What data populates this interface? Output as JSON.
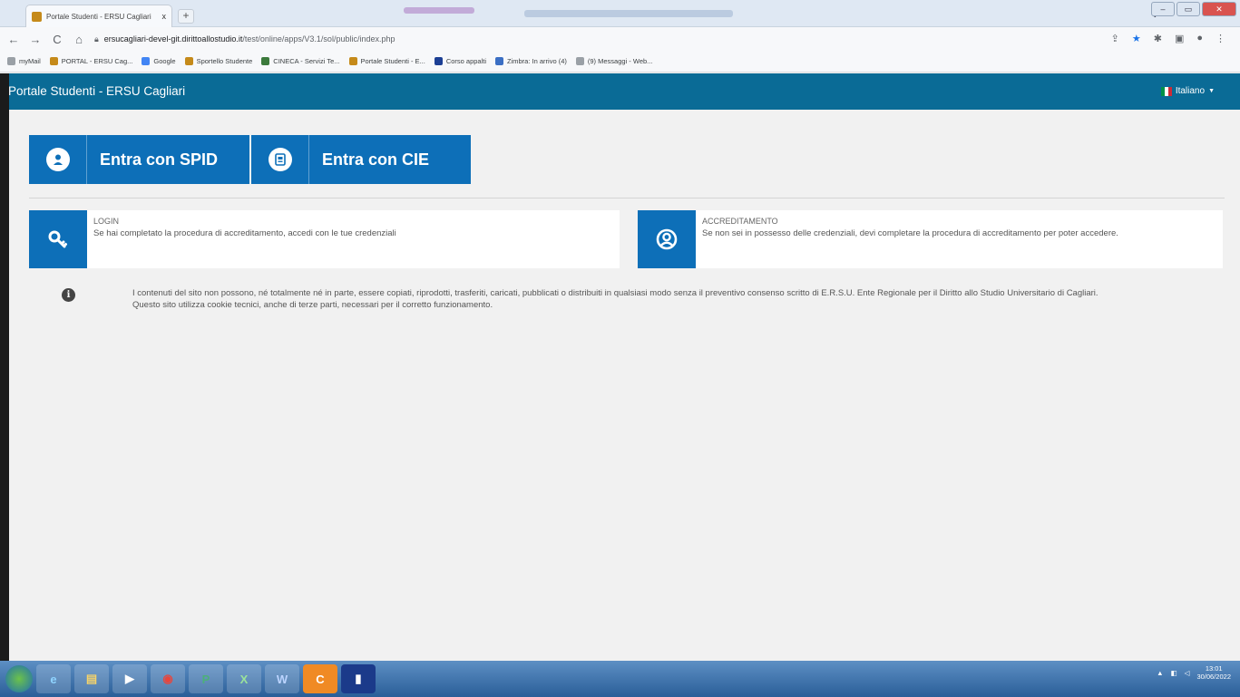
{
  "browser": {
    "tab_title": "Portale Studenti - ERSU Cagliari",
    "tab_close": "x",
    "new_tab": "+",
    "url_host": "ersucagliari-devel-git.dirittoallostudio.it",
    "url_path": "/test/online/apps/V3.1/sol/public/index.php",
    "bookmarks": [
      {
        "label": "myMail",
        "color": "#9aa0a6"
      },
      {
        "label": "PORTAL - ERSU Cag...",
        "color": "#c58a1a"
      },
      {
        "label": "Google",
        "color": "#4285f4"
      },
      {
        "label": "Sportello Studente",
        "color": "#c58a1a"
      },
      {
        "label": "CINECA - Servizi Te...",
        "color": "#3c7a3c"
      },
      {
        "label": "Portale Studenti - E...",
        "color": "#c58a1a"
      },
      {
        "label": "Corso appalti",
        "color": "#1c3f94"
      },
      {
        "label": "Zimbra: In arrivo (4)",
        "color": "#3b6fc4"
      },
      {
        "label": "(9) Messaggi - Web...",
        "color": "#9aa0a6"
      }
    ]
  },
  "header": {
    "brand": "Portale Studenti - ERSU Cagliari",
    "language": "Italiano"
  },
  "login_buttons": {
    "spid": "Entra con SPID",
    "cie": "Entra con CIE"
  },
  "cards": {
    "login": {
      "title": "LOGIN",
      "text": "Se hai completato la procedura di accreditamento, accedi con le tue credenziali"
    },
    "accreditamento": {
      "title": "ACCREDITAMENTO",
      "text": "Se non sei in possesso delle credenziali, devi completare la procedura di accreditamento per poter accedere."
    }
  },
  "notice": {
    "line1": "I contenuti del sito non possono, né totalmente né in parte, essere copiati, riprodotti, trasferiti, caricati, pubblicati o distribuiti in qualsiasi modo senza il preventivo consenso scritto di E.R.S.U. Ente Regionale per il Diritto allo Studio Universitario di Cagliari.",
    "line2": "Questo sito utilizza cookie tecnici, anche di terze parti, necessari per il corretto funzionamento."
  },
  "taskbar": {
    "time": "13:01",
    "date": "30/06/2022"
  },
  "colors": {
    "header_bg": "#0a6b96",
    "button_blue": "#0d6fb8"
  }
}
